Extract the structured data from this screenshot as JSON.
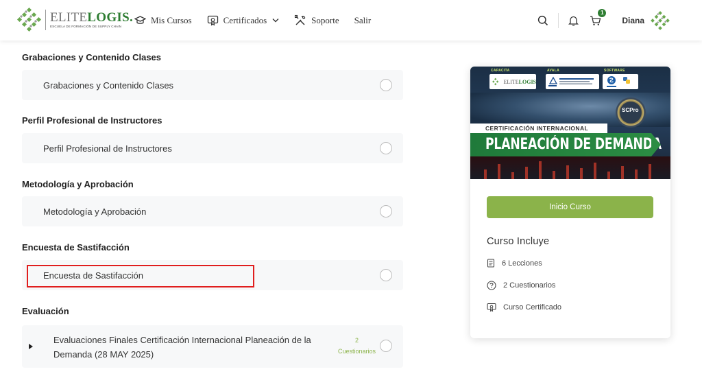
{
  "header": {
    "logo": {
      "brand_elite": "ELITE",
      "brand_logis": "LOGIS.",
      "tagline": "ESCUELA DE FORMACIÓN DE SUPPLY CHAIN"
    },
    "nav": [
      {
        "label": "Mis Cursos",
        "icon": "graduation-cap-icon"
      },
      {
        "label": "Certificados",
        "icon": "certificate-icon",
        "dropdown": true
      },
      {
        "label": "Soporte",
        "icon": "tools-icon"
      },
      {
        "label": "Salir",
        "icon": null
      }
    ],
    "cart_count": "1",
    "user_name": "Diana"
  },
  "curriculum": {
    "sections": [
      {
        "title": "Grabaciones y Contenido Clases",
        "lesson": "Grabaciones y Contenido Clases"
      },
      {
        "title": "Perfil Profesional de Instructores",
        "lesson": "Perfil Profesional de Instructores"
      },
      {
        "title": "Metodología y Aprobación",
        "lesson": "Metodología y Aprobación"
      },
      {
        "title": "Encuesta de Sastifacción",
        "lesson": "Encuesta de Sastifacción"
      },
      {
        "title": "Evaluación",
        "lesson": "Evaluaciones Finales Certificación Internacional Planeación de la Demanda (28 MAY 2025)"
      }
    ],
    "quiz_count": "2",
    "quiz_label": "Cuestionarios"
  },
  "card": {
    "banner": {
      "label_capacita": "CAPACITA",
      "label_avala": "AVALA",
      "label_software": "SOFTWARE",
      "logo_elite": "ELITE",
      "logo_logis": "LOGIS",
      "seal": "SCPro",
      "subtitle": "CERTIFICACIÓN INTERNACIONAL",
      "title": "PLANEACIÓN DE DEMANDA"
    },
    "start_button": "Inicio Curso",
    "includes_title": "Curso Incluye",
    "includes": [
      {
        "label": "6 Lecciones",
        "icon": "document-icon"
      },
      {
        "label": "2 Cuestionarios",
        "icon": "question-icon"
      },
      {
        "label": "Curso Certificado",
        "icon": "certificate-icon"
      }
    ]
  },
  "colors": {
    "accent_green": "#8bb34a",
    "brand_green": "#2e7d32",
    "highlight_red": "#e01e1e"
  }
}
